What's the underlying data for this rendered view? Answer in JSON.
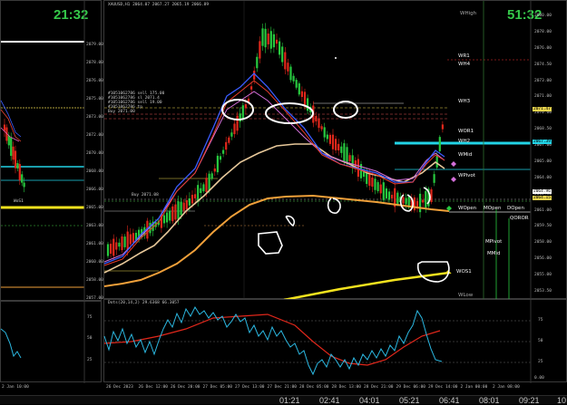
{
  "left_chart": {
    "clock": "21:32",
    "price_ticks": [
      "2079.00",
      "2078.00",
      "2076.00",
      "2075.00",
      "2073.00",
      "2072.00",
      "2070.00",
      "2068.00",
      "2066.00",
      "2065.00",
      "2063.00",
      "2061.00",
      "2060.00",
      "2058.00",
      "2057.00"
    ],
    "level_labels": [
      "2071.85",
      "2066.84",
      "2063.47",
      "2063.74",
      "2062.22"
    ],
    "marker": "WoS1",
    "osc_ticks": [
      "75",
      "50",
      "25"
    ],
    "time_label": "2 Jan 10:00"
  },
  "main_chart": {
    "header": "XAUUSD,H1  2064.07 2067.27 2065.19 2066.89",
    "clock": "51:32",
    "info_lines": [
      "#1051062786 sell 175.00",
      "#1051062786 sl 2071.4",
      "#1051062786 sell 19.00",
      "#1051062786 tp",
      "Buy 2071.00"
    ],
    "mid_label": "Buy 2071.08",
    "pivot_labels": [
      "WHigh",
      "WR1",
      "WH4",
      "WH3",
      "WOR1",
      "WH2",
      "WMid",
      "WPivot",
      "WOpen",
      "MOpen",
      "DOpen",
      "QOROR",
      "MPivot",
      "MMid",
      "WOS1",
      "WLow"
    ],
    "price_ticks": [
      "2080.00",
      "2078.00",
      "2076.00",
      "2074.50",
      "2073.00",
      "2071.00",
      "2070.00",
      "2068.50",
      "2067.00",
      "2065.00",
      "2064.00",
      "2062.50",
      "2061.00",
      "2059.50",
      "2058.00",
      "2056.00",
      "2055.00",
      "2053.50"
    ],
    "tags": [
      "2071.47",
      "2067.39",
      "2064.96",
      "2064.15"
    ],
    "osc_header": "Dots(20,14,2) 29.6368 66.3057",
    "osc_ticks": [
      "75",
      "50",
      "25",
      "0.00"
    ],
    "time_axis": [
      "26 Dec 2023",
      "26 Dec 12:00",
      "26 Dec 20:00",
      "27 Dec 05:00",
      "27 Dec 13:00",
      "27 Dec 21:00",
      "28 Dec 05:00",
      "28 Dec 13:00",
      "28 Dec 21:00",
      "29 Dec 06:00",
      "29 Dec 14:00",
      "2 Jan 00:00",
      "2 Jan 08:00"
    ]
  },
  "taskbar": {
    "items": [
      "01:21",
      "02:41",
      "04:01",
      "05:21",
      "06:41",
      "08:01",
      "09:21",
      "10"
    ]
  },
  "colors": {
    "bull": "#27c93f",
    "bear": "#e0271b",
    "clock": "#35c84a",
    "cyan": "#22d3e6",
    "yellow": "#f2e21e",
    "orange": "#f0a03a"
  }
}
